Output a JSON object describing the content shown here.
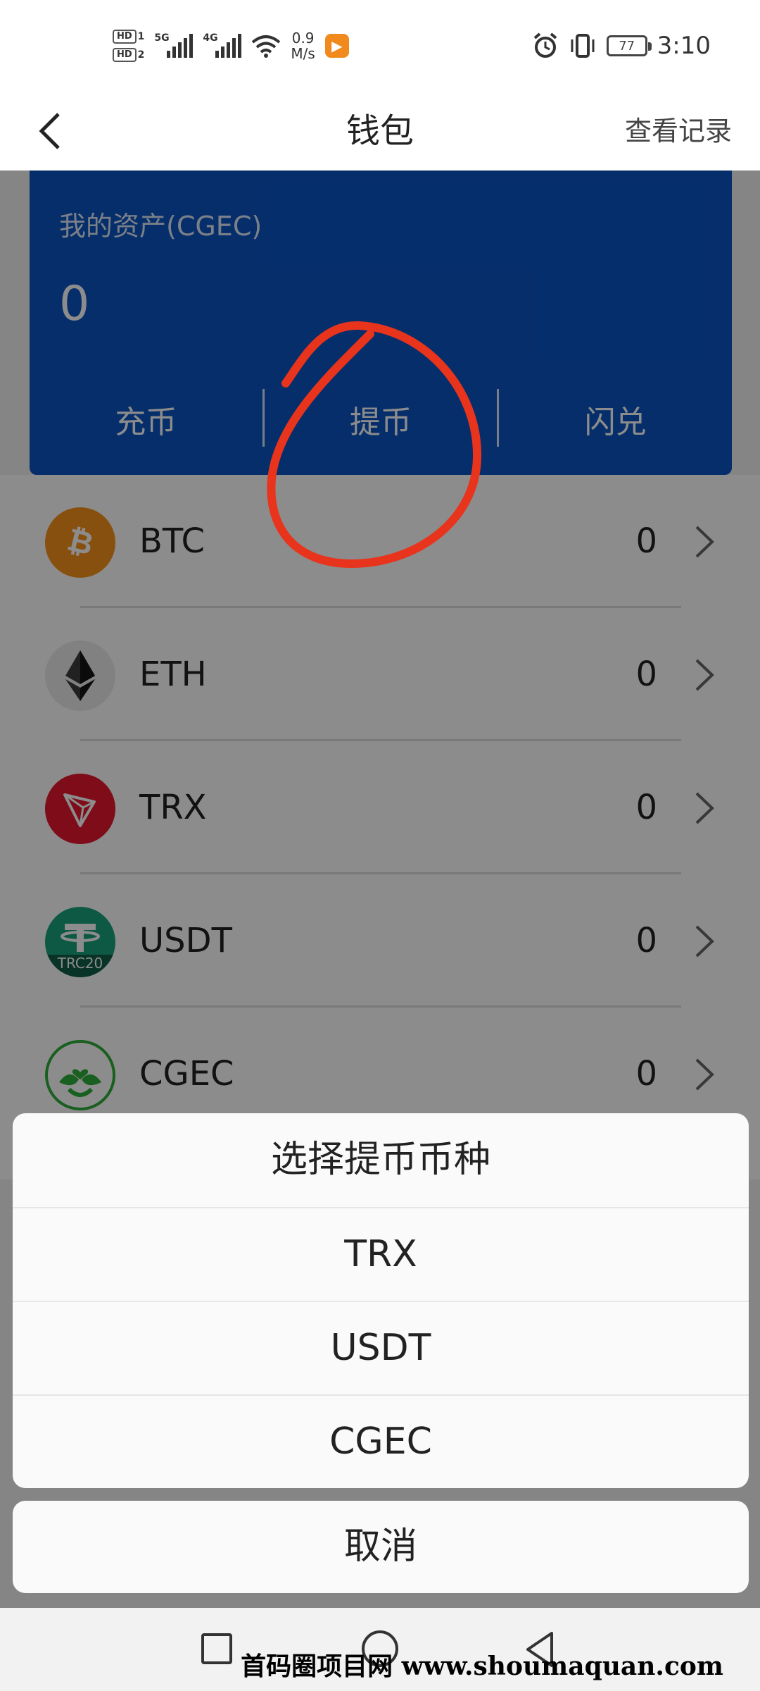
{
  "status_bar": {
    "hd1": "HD",
    "hd1_sim": "1",
    "hd2": "HD",
    "hd2_sim": "2",
    "net1": "5G",
    "net2": "4G",
    "speed_value": "0.9",
    "speed_unit": "M/s",
    "battery": "77",
    "time": "3:10",
    "icons": [
      "wifi-icon",
      "alarm-icon",
      "vibrate-icon",
      "battery-icon"
    ]
  },
  "header": {
    "title": "钱包",
    "history_label": "查看记录"
  },
  "asset_card": {
    "label": "我的资产(CGEC)",
    "value": "0",
    "actions": [
      "充币",
      "提币",
      "闪兑"
    ],
    "background_color": "#0a55c4"
  },
  "coins": [
    {
      "symbol": "BTC",
      "balance": "0",
      "logo_color": "#f7931a"
    },
    {
      "symbol": "ETH",
      "balance": "0",
      "logo_color": "#ececec"
    },
    {
      "symbol": "TRX",
      "balance": "0",
      "logo_color": "#e5162e"
    },
    {
      "symbol": "USDT",
      "balance": "0",
      "logo_color": "#1ba27a",
      "logo_text": "TRC20"
    },
    {
      "symbol": "CGEC",
      "balance": "0",
      "logo_color": "#2fae3a"
    }
  ],
  "action_sheet": {
    "title": "选择提币币种",
    "options": [
      "TRX",
      "USDT",
      "CGEC"
    ],
    "cancel_label": "取消"
  },
  "nav_bar": {
    "icons": [
      "square-icon",
      "circle-icon",
      "back-triangle-icon"
    ]
  },
  "watermark": "首码圈项目网 www.shoumaquan.com",
  "annotation_color": "#e8341c"
}
